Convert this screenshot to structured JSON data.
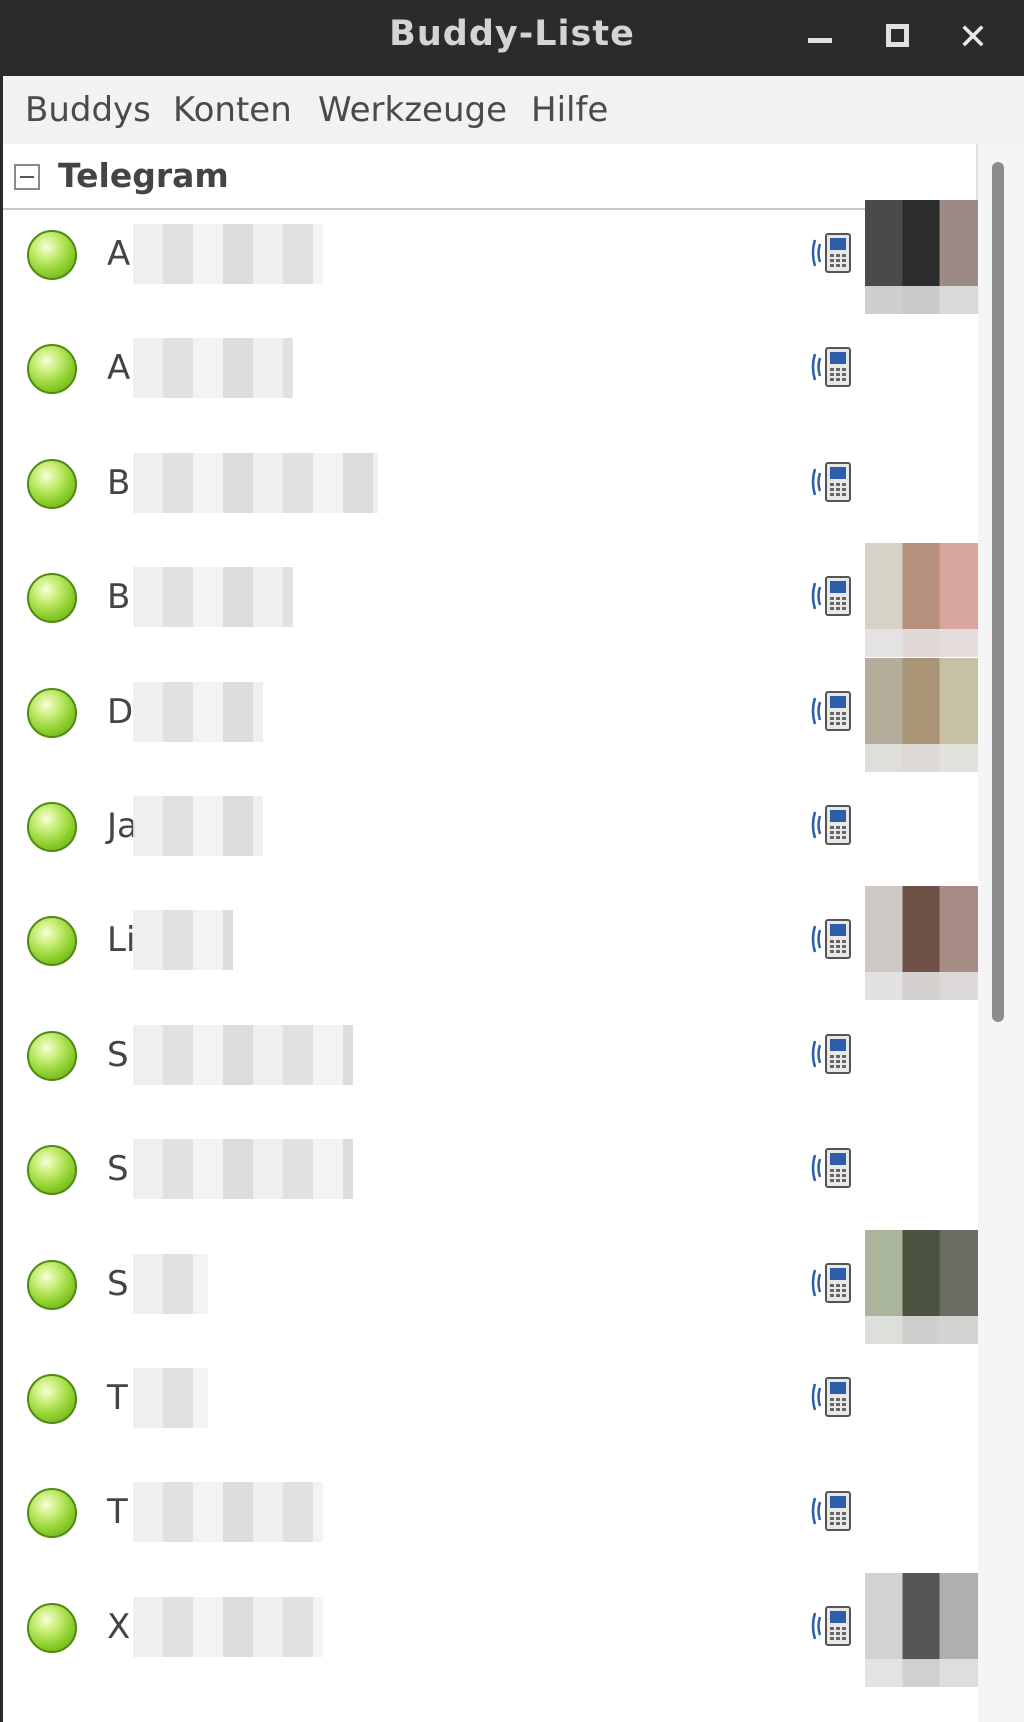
{
  "window": {
    "title": "Buddy-Liste"
  },
  "menu": [
    "Buddys",
    "Konten",
    "Werkzeuge",
    "Hilfe"
  ],
  "group": {
    "name": "Telegram"
  },
  "buddies": [
    {
      "initial": "A",
      "avatar": [
        "#4a4a4a",
        "#2c2c2c",
        "#9c8a86"
      ]
    },
    {
      "initial": "A",
      "avatar": null
    },
    {
      "initial": "B",
      "avatar": null
    },
    {
      "initial": "B",
      "avatar": [
        "#d6d2c6",
        "#b8907e",
        "#d8a69c"
      ]
    },
    {
      "initial": "D",
      "avatar": [
        "#b4ad9c",
        "#a99575",
        "#c8c0a4"
      ]
    },
    {
      "initial": "Ja",
      "avatar": null
    },
    {
      "initial": "Li",
      "avatar": [
        "#cfc9c5",
        "#6d5147",
        "#a88c86"
      ]
    },
    {
      "initial": "S",
      "avatar": null
    },
    {
      "initial": "S",
      "avatar": null
    },
    {
      "initial": "S",
      "avatar": [
        "#a9b59c",
        "#4a5240",
        "#6b6a63"
      ]
    },
    {
      "initial": "T",
      "avatar": null
    },
    {
      "initial": "T",
      "avatar": null
    },
    {
      "initial": "X",
      "avatar": [
        "#d2d2d2",
        "#555555",
        "#b0b0b0"
      ]
    }
  ]
}
